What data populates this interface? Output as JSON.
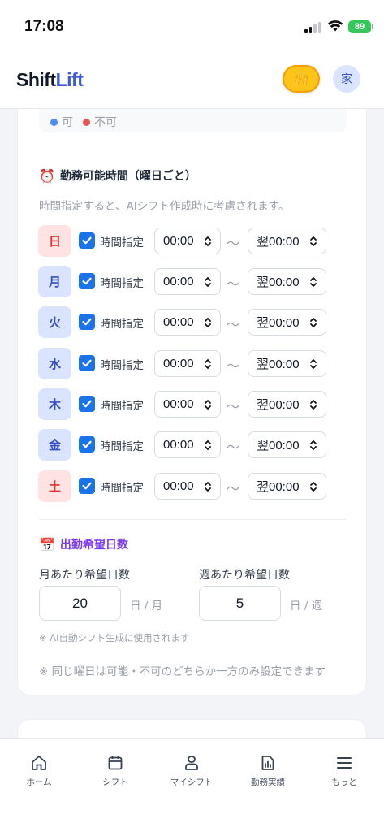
{
  "status_bar": {
    "time": "17:08",
    "battery": "89"
  },
  "header": {
    "logo_part1": "Shift",
    "logo_part2": "Lift",
    "hands_emoji": "🙌",
    "avatar": "家"
  },
  "legend": {
    "available": "可",
    "unavailable": "不可",
    "available_color": "#4d8df6",
    "unavailable_color": "#f05252"
  },
  "availability": {
    "title": "勤務可能時間（曜日ごと）",
    "icon": "⏰",
    "hint": "時間指定すると、AIシフト作成時に考慮されます。",
    "tilde": "〜",
    "rows": [
      {
        "day": "日",
        "checked": true,
        "label": "時間指定",
        "start": "00:00",
        "end": "翌00:00"
      },
      {
        "day": "月",
        "checked": true,
        "label": "時間指定",
        "start": "00:00",
        "end": "翌00:00"
      },
      {
        "day": "火",
        "checked": true,
        "label": "時間指定",
        "start": "00:00",
        "end": "翌00:00"
      },
      {
        "day": "水",
        "checked": true,
        "label": "時間指定",
        "start": "00:00",
        "end": "翌00:00"
      },
      {
        "day": "木",
        "checked": true,
        "label": "時間指定",
        "start": "00:00",
        "end": "翌00:00"
      },
      {
        "day": "金",
        "checked": true,
        "label": "時間指定",
        "start": "00:00",
        "end": "翌00:00"
      },
      {
        "day": "土",
        "checked": true,
        "label": "時間指定",
        "start": "00:00",
        "end": "翌00:00"
      }
    ]
  },
  "desired_days": {
    "title": "出勤希望日数",
    "icon": "📅",
    "monthly_label": "月あたり希望日数",
    "monthly_value": "20",
    "monthly_unit": "日 / 月",
    "weekly_label": "週あたり希望日数",
    "weekly_value": "5",
    "weekly_unit": "日 / 週",
    "note_ai": "※ AI自動シフト生成に使用されます",
    "note_rule": "※ 同じ曜日は可能・不可のどちらか一方のみ設定できます"
  },
  "nav": [
    {
      "label": "ホーム",
      "icon": "home-icon"
    },
    {
      "label": "シフト",
      "icon": "calendar-icon"
    },
    {
      "label": "マイシフト",
      "icon": "user-icon"
    },
    {
      "label": "勤務実績",
      "icon": "report-icon"
    },
    {
      "label": "もっと",
      "icon": "menu-icon"
    }
  ]
}
